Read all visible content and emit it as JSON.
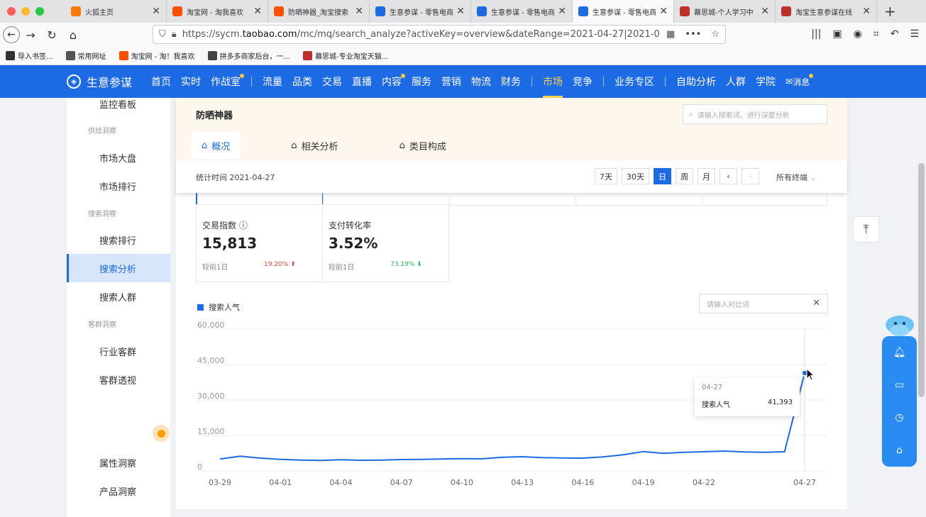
{
  "browser": {
    "tabs": [
      {
        "label": "火狐主页",
        "icon_color": "#ff7a00"
      },
      {
        "label": "淘宝网 - 淘我喜欢",
        "icon_color": "#ff5000"
      },
      {
        "label": "防晒神器_淘宝搜索",
        "icon_color": "#ff5000"
      },
      {
        "label": "生意参谋 - 零售电商",
        "icon_color": "#1d6ae5"
      },
      {
        "label": "生意参谋 - 零售电商",
        "icon_color": "#1d6ae5"
      },
      {
        "label": "生意参谋 - 零售电商",
        "icon_color": "#1d6ae5"
      },
      {
        "label": "幕思城-个人学习中",
        "icon_color": "#c0302b"
      },
      {
        "label": "淘宝生意参谋在线",
        "icon_color": "#c0302b"
      }
    ],
    "url_prefix": "https://sycm.",
    "url_host": "taobao.com",
    "url_path": "/mc/mq/search_analyze?activeKey=overview&dateRange=2021-04-27|2021-04-27&dateT",
    "bookmarks": [
      {
        "label": "导入书签...",
        "icon_color": "#333333"
      },
      {
        "label": "常用网址",
        "icon_color": "#555555"
      },
      {
        "label": "淘宝网 - 淘！我喜欢",
        "icon_color": "#ff5000"
      },
      {
        "label": "拼多多商家后台，一...",
        "icon_color": "#444444"
      },
      {
        "label": "幕思城-专业淘宝天猫...",
        "icon_color": "#c0302b"
      }
    ]
  },
  "header": {
    "brand": "生意参谋",
    "nav1": [
      "首页",
      "实时",
      "作战室"
    ],
    "nav2": [
      "流量",
      "品类",
      "交易",
      "直播",
      "内容",
      "服务",
      "营销",
      "物流",
      "财务"
    ],
    "nav3_active": "市场",
    "nav3": [
      "竞争"
    ],
    "nav4": [
      "业务专区"
    ],
    "nav5": [
      "自助分析",
      "人群",
      "学院"
    ],
    "message": "消息",
    "accent": "#1d6ae5"
  },
  "sidebar": {
    "items": [
      {
        "label": "监控看板",
        "top": 0
      },
      {
        "group": "供给洞察"
      },
      {
        "label": "市场大盘"
      },
      {
        "label": "市场排行"
      },
      {
        "group": "搜索洞察"
      },
      {
        "label": "搜索排行"
      },
      {
        "label": "搜索分析",
        "active": true
      },
      {
        "label": "搜索人群"
      },
      {
        "group": "客群洞察"
      },
      {
        "label": "行业客群"
      },
      {
        "label": "客群透视"
      },
      {
        "label": "属性洞察"
      },
      {
        "label": "产品洞察"
      }
    ]
  },
  "main": {
    "keyword": "防晒神器",
    "search_placeholder": "请输入搜索词，进行深度分析",
    "subtabs": [
      "概况",
      "相关分析",
      "类目构成"
    ],
    "stat_time": "统计时间 2021-04-27",
    "range_buttons": [
      "7天",
      "30天",
      "日",
      "周",
      "月"
    ],
    "range_active": "日",
    "terminal": "所有终端",
    "metrics": [
      {
        "title": "交易指数",
        "value": "15,813",
        "compare": "较前1日",
        "pct": "19.20%",
        "dir": "up"
      },
      {
        "title": "支付转化率",
        "value": "3.52%",
        "compare": "较前1日",
        "pct": "73.19%",
        "dir": "down"
      }
    ],
    "compare_placeholder": "请输入对比词",
    "tooltip": {
      "date": "04-27",
      "label": "搜索人气",
      "value": "41,393"
    }
  },
  "chart_data": {
    "type": "line",
    "legend_position": "top-left",
    "grid": true,
    "ylim": [
      0,
      60000
    ],
    "yticks": [
      "60,000",
      "45,000",
      "30,000",
      "15,000",
      "0"
    ],
    "xtick_labels": [
      "03-29",
      "04-01",
      "04-04",
      "04-07",
      "04-10",
      "04-13",
      "04-16",
      "04-19",
      "04-22",
      "04-27"
    ],
    "series": [
      {
        "name": "搜索人气",
        "color": "#1d6ae5",
        "x": [
          "03-29",
          "03-30",
          "03-31",
          "04-01",
          "04-02",
          "04-03",
          "04-04",
          "04-05",
          "04-06",
          "04-07",
          "04-08",
          "04-09",
          "04-10",
          "04-11",
          "04-12",
          "04-13",
          "04-14",
          "04-15",
          "04-16",
          "04-17",
          "04-18",
          "04-19",
          "04-20",
          "04-21",
          "04-22",
          "04-23",
          "04-24",
          "04-25",
          "04-26",
          "04-27"
        ],
        "values": [
          5000,
          6200,
          5400,
          4900,
          4600,
          4400,
          4700,
          4500,
          4600,
          4800,
          4900,
          5000,
          5200,
          5100,
          5800,
          6000,
          5600,
          5500,
          5400,
          5900,
          6800,
          8200,
          7400,
          7900,
          8100,
          8400,
          8000,
          7900,
          8100,
          41393
        ]
      }
    ]
  }
}
